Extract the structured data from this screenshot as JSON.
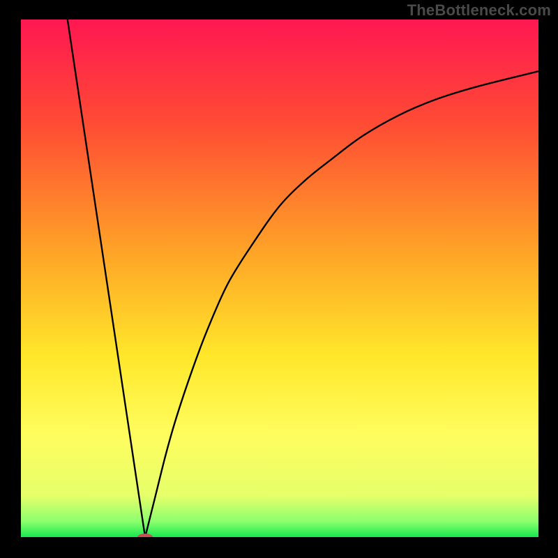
{
  "watermark": "TheBottleneck.com",
  "chart_data": {
    "type": "line",
    "title": "",
    "xlabel": "",
    "ylabel": "",
    "xlim": [
      0,
      100
    ],
    "ylim": [
      0,
      100
    ],
    "gradient_stops": [
      {
        "offset": 0,
        "color": "#ff1752"
      },
      {
        "offset": 20,
        "color": "#ff4b34"
      },
      {
        "offset": 45,
        "color": "#ffa427"
      },
      {
        "offset": 65,
        "color": "#ffe72a"
      },
      {
        "offset": 80,
        "color": "#fffd5e"
      },
      {
        "offset": 92,
        "color": "#e6ff6a"
      },
      {
        "offset": 97,
        "color": "#8cff6e"
      },
      {
        "offset": 100,
        "color": "#17e84e"
      }
    ],
    "optimum_x": 24,
    "marker": {
      "x": 24,
      "y": 0,
      "color": "#c94f55",
      "rx": 11,
      "ry": 5
    },
    "series": [
      {
        "name": "left-branch",
        "x": [
          9,
          24
        ],
        "y": [
          100,
          0
        ]
      },
      {
        "name": "right-branch",
        "x": [
          24,
          26,
          28,
          30,
          33,
          36,
          40,
          45,
          50,
          55,
          60,
          66,
          73,
          80,
          88,
          100
        ],
        "y": [
          0,
          8,
          16,
          23,
          32,
          40,
          49,
          57,
          64,
          69,
          73,
          77.5,
          81.5,
          84.5,
          87,
          90
        ]
      }
    ]
  }
}
